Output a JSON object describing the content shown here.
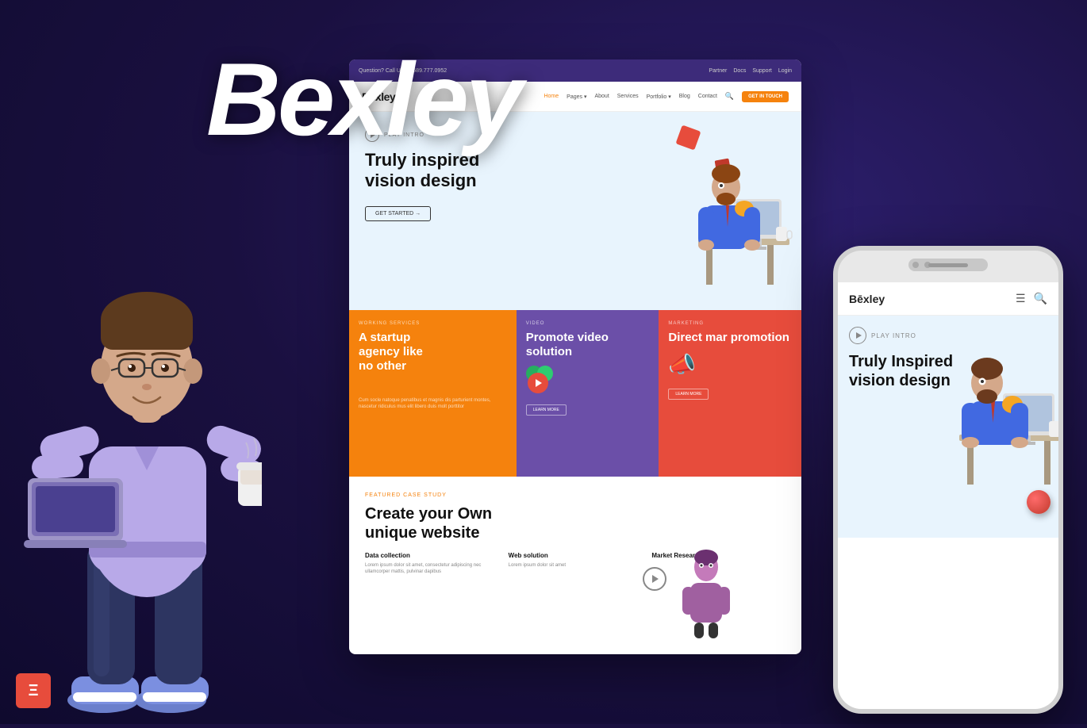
{
  "brand": {
    "title": "Bexley",
    "logo": "Bēxley",
    "tagline": "A startup agency like no other"
  },
  "background": {
    "color": "#1a1040"
  },
  "desktop_mockup": {
    "topbar": {
      "phone": "Question? Call Us +1 589.777.0952",
      "links": [
        "Partner",
        "Docs",
        "Support",
        "Login"
      ]
    },
    "nav": {
      "logo": "Bēxley",
      "items": [
        "Home",
        "Pages",
        "About",
        "Services",
        "Portfolio",
        "Blog",
        "Contact"
      ],
      "cta": "GET IN TOUCH",
      "active": "Home"
    },
    "hero": {
      "play_label": "PLAY INTRO",
      "title_line1": "Truly inspired",
      "title_line2": "vision design",
      "cta": "GET STARTED →"
    },
    "services": {
      "card1": {
        "label": "WORKING SERVICES",
        "title": "A startup agency like no other",
        "text": "Cum socle natoque penatibus et magnis dis parturient montes, nascetur ridiculus mus elit libero duis molt porttitor"
      },
      "card2": {
        "label": "VIDEO",
        "title": "Promote video solution",
        "learn_more": "LEARN MORE"
      },
      "card3": {
        "label": "MARKETING",
        "title": "Direct mar promotion",
        "learn_more": "LEARN MORE"
      }
    },
    "case_study": {
      "label": "FEATURED CASE STUDY",
      "title_line1": "Create your Own",
      "title_line2": "unique website",
      "items": [
        {
          "title": "Data collection",
          "text": "Lorem ipsum dolor sit amet, consectetur adipiscing nec ullamcorper mattis, pulvinar dapibus"
        },
        {
          "title": "Web solution",
          "text": "Lorem ipsum dolor sit amet"
        },
        {
          "title": "Market Research",
          "text": ""
        }
      ]
    }
  },
  "mobile_mockup": {
    "nav": {
      "logo": "Bēxley"
    },
    "hero": {
      "play_label": "PLAY INTRO",
      "title_line1": "Truly Inspired",
      "title_line2": "vision design"
    }
  },
  "elementor_badge": {
    "symbol": "Ξ"
  }
}
